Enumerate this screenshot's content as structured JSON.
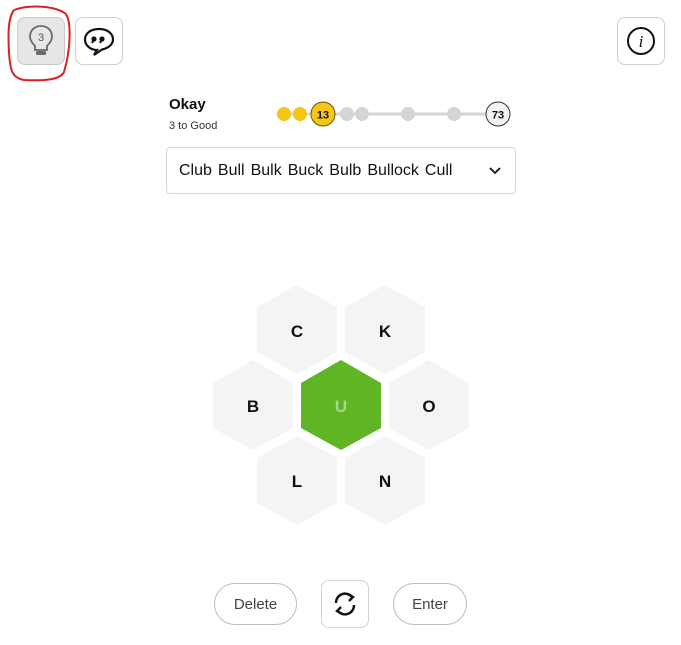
{
  "toolbar": {
    "hint_count": "3",
    "info_symbol": "i"
  },
  "rank": {
    "name": "Okay",
    "subtitle": "3 to Good",
    "current_score": "13",
    "max_score": "73"
  },
  "found_words": [
    "Club",
    "Bull",
    "Bulk",
    "Buck",
    "Bulb",
    "Bullock",
    "Cull"
  ],
  "hive": {
    "center": "U",
    "outer": {
      "top_left": "C",
      "top_right": "K",
      "left": "B",
      "right": "O",
      "bottom_left": "L",
      "bottom_right": "N"
    }
  },
  "controls": {
    "delete_label": "Delete",
    "enter_label": "Enter"
  },
  "colors": {
    "accent_green": "#5fb524",
    "score_yellow": "#f5c518",
    "hex_gray": "#f4f4f4",
    "annotation_red": "#d92027"
  }
}
